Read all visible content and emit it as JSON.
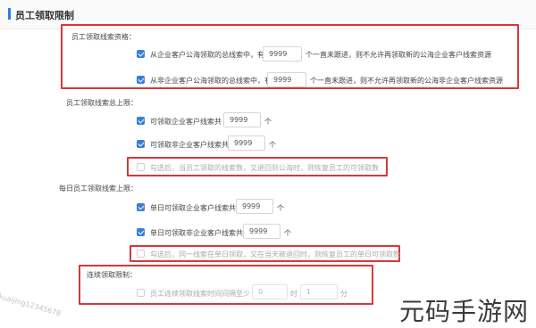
{
  "header": {
    "title": "员工领取限制"
  },
  "sections": {
    "total_qualification": {
      "title": "员工领取线索资格：",
      "rule1": {
        "label": "从企业客户公海领取的总线索中，有",
        "value": "9999",
        "suffix": "个一直未跟进，则不允许再领取新的公海企业客户线索资源",
        "checked": true
      },
      "rule2": {
        "label": "从非企业客户公海领取的总线索中，有",
        "value": "9999",
        "suffix": "个一直未跟进，则不允许再领取新的公海非企业客户线索资源",
        "checked": true
      }
    },
    "total_limit": {
      "title": "员工领取线索总上限：",
      "rule1": {
        "label": "可领取企业客户线索共",
        "value": "9999",
        "unit": "个",
        "checked": true
      },
      "rule2": {
        "label": "可领取非企业客户线索共",
        "value": "9999",
        "unit": "个",
        "checked": true
      },
      "restore": {
        "label": "勾选后，当员工领取的线索数，又退回到公海时，则恢复员工的可领取数",
        "checked": false
      }
    },
    "daily_limit": {
      "title": "每日员工领取线索上限：",
      "rule1": {
        "label": "单日可领取企业客户线索共",
        "value": "9999",
        "unit": "个",
        "checked": true
      },
      "rule2": {
        "label": "单日可领取非企业客户线索共",
        "value": "9999",
        "unit": "个",
        "checked": true
      },
      "restore": {
        "label": "勾选后，同一线索在单日领取，又在当天被退回时，则恢复员工的单日可领取数",
        "checked": false
      }
    },
    "consecutive": {
      "title": "连续领取限制：",
      "rule": {
        "label": "员工连续领取线索时间间隔至少",
        "minutes": "0",
        "minutes_unit": "时",
        "seconds": "1",
        "seconds_unit": "分",
        "checked": false
      }
    }
  },
  "watermark": "kuaijing12345678",
  "brand": "元码手游网",
  "colors": {
    "accent": "#2f7fe0",
    "checkbox": "#3a7fd6",
    "highlight": "#d9373a"
  }
}
